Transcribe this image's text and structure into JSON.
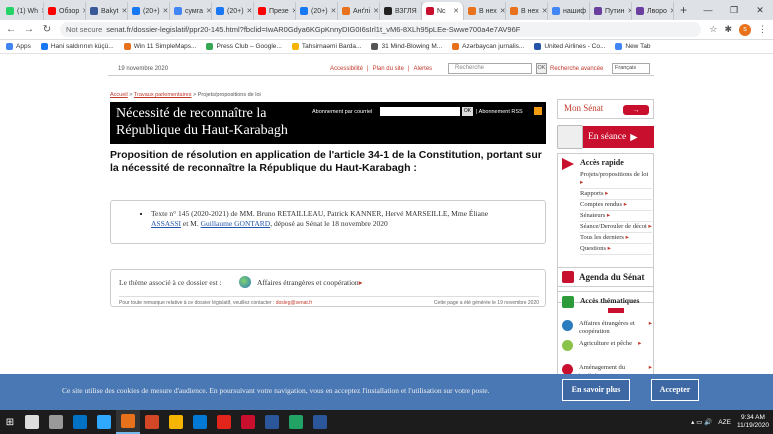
{
  "browser": {
    "tabs": [
      {
        "label": "(1) Wh",
        "color": "#25d366"
      },
      {
        "label": "Обзор",
        "color": "#ff0000"
      },
      {
        "label": "Bakyt",
        "color": "#3b5998"
      },
      {
        "label": "(20+)",
        "color": "#1877f2"
      },
      {
        "label": "сумга",
        "color": "#4285f4"
      },
      {
        "label": "(20+)",
        "color": "#1877f2"
      },
      {
        "label": "Презе",
        "color": "#ff0000"
      },
      {
        "label": "(20+)",
        "color": "#1877f2"
      },
      {
        "label": "Анґлі",
        "color": "#e8711c"
      },
      {
        "label": "ВЗГЛЯ",
        "color": "#222222"
      },
      {
        "label": "Nc",
        "color": "#c8102e",
        "active": true
      },
      {
        "label": "В нех",
        "color": "#e8711c"
      },
      {
        "label": "В нех",
        "color": "#e8711c"
      },
      {
        "label": "нашиф",
        "color": "#4285f4"
      },
      {
        "label": "Путин",
        "color": "#6a3fa0"
      },
      {
        "label": "Лворо",
        "color": "#6a3fa0"
      }
    ],
    "new_tab": "+",
    "window_controls": [
      "—",
      "❐",
      "✕"
    ],
    "nav": {
      "back": "←",
      "forward": "→",
      "reload": "↻"
    },
    "url_security": "Not secure",
    "url": "senat.fr/dossier-legislatif/ppr20-145.html?fbclid=IwAR0Gdya6KGpKnnyDIG0I6sIrl1t_vM6-8XLh95pLEe-Swwe700a4e7AV96F",
    "profile_initial": "s",
    "bookmarks": [
      {
        "label": "Apps",
        "color": "#4285f4"
      },
      {
        "label": "Hani saldırının küçü...",
        "color": "#1877f2"
      },
      {
        "label": "Win 11 SimpleMaps...",
        "color": "#e8711c"
      },
      {
        "label": "Press Club – Google...",
        "color": "#34a853"
      },
      {
        "label": "Tahsirnaəmi Barda...",
        "color": "#f4b400"
      },
      {
        "label": "31 Mind-Blowing M...",
        "color": "#555555"
      },
      {
        "label": "Azərbaycan jurnalis...",
        "color": "#e8711c"
      },
      {
        "label": "United Airlines - Co...",
        "color": "#2255aa"
      },
      {
        "label": "New Tab",
        "color": "#4285f4"
      }
    ]
  },
  "site": {
    "date": "19 novembre 2020",
    "utility_links": [
      "Accessibilité",
      "Plan du site",
      "Alertes"
    ],
    "search_placeholder": "Recherche",
    "ok": "OK",
    "advanced_search": "Recherche avancée",
    "language": "Français",
    "breadcrumb_links": [
      "Accueil",
      "Travaux parlementaires"
    ],
    "breadcrumb_current": "Projets/propositions de loi",
    "title": "Nécessité de reconnaître la République du Haut-Karabagh",
    "subscribe_label": "Abonnement par courriel",
    "rss_label": "| Abonnement RSS",
    "headline": "Proposition de résolution en application de l'article 34-1 de la Constitution, portant sur la nécessité de reconnaître la République du Haut-Karabagh :",
    "text_before": "Texte n° 145 (2020-2021) de MM. Bruno RETAILLEAU, Patrick KANNER, Hervé MARSEILLE, Mme Éliane ",
    "author_link_1": "ASSASSI",
    "text_middle": " et M. ",
    "author_link_2": "Guillaume GONTARD",
    "text_after": ", déposé au Sénat le 18 novembre 2020",
    "theme_label": "Le thème associé à ce dossier est :",
    "theme_value": "Affaires étrangères et coopération",
    "footer_note": "Pour toute remarque relative à ce dossier législatif, veuillez contacter :",
    "footer_email": "dosleg@senat.fr",
    "footer_generated": "Cette page a été générée le 19 novembre 2020"
  },
  "sidebar": {
    "mon_senat": "Mon Sénat",
    "en_seance": "En séance",
    "acces_rapide": "Accès rapide",
    "quick_links": [
      "Projets/propositions de loi",
      "Rapports",
      "Comptes rendus",
      "Sénateurs",
      "Séance/Derouler de décot",
      "Tous les derniers",
      "Questions"
    ],
    "agenda": "Agenda du Sénat",
    "acces_thematiques": "Accès thématiques",
    "themes": [
      {
        "label": "Affaires étrangères et coopération",
        "color": "#2b7bbf"
      },
      {
        "label": "Agriculture et pêche",
        "color": "#8bc34a"
      },
      {
        "label": "Aménagement du territoire",
        "color": "#c8102e"
      }
    ]
  },
  "cookie": {
    "message": "Ce site utilise des cookies de mesure d'audience. En poursuivant votre navigation, vous en acceptez l'installation et l'utilisation sur votre poste.",
    "more": "En savoir plus",
    "accept": "Accepter"
  },
  "taskbar": {
    "apps": [
      {
        "name": "search",
        "color": "#dddddd"
      },
      {
        "name": "task-view",
        "color": "#999999"
      },
      {
        "name": "outlook",
        "color": "#0072c6"
      },
      {
        "name": "photoshop",
        "color": "#31a8ff"
      },
      {
        "name": "chrome",
        "color": "#e8711c",
        "active": true
      },
      {
        "name": "powerpoint",
        "color": "#d24726"
      },
      {
        "name": "explorer",
        "color": "#f4b400"
      },
      {
        "name": "word-mail",
        "color": "#0078d4"
      },
      {
        "name": "acrobat",
        "color": "#e1251b"
      },
      {
        "name": "app-red",
        "color": "#c8102e"
      },
      {
        "name": "app-blue",
        "color": "#2b579a"
      },
      {
        "name": "app-green",
        "color": "#21a366"
      },
      {
        "name": "word",
        "color": "#2b579a"
      }
    ],
    "tray_lang": "AZE",
    "time": "9:34 AM",
    "date": "11/19/2020"
  }
}
